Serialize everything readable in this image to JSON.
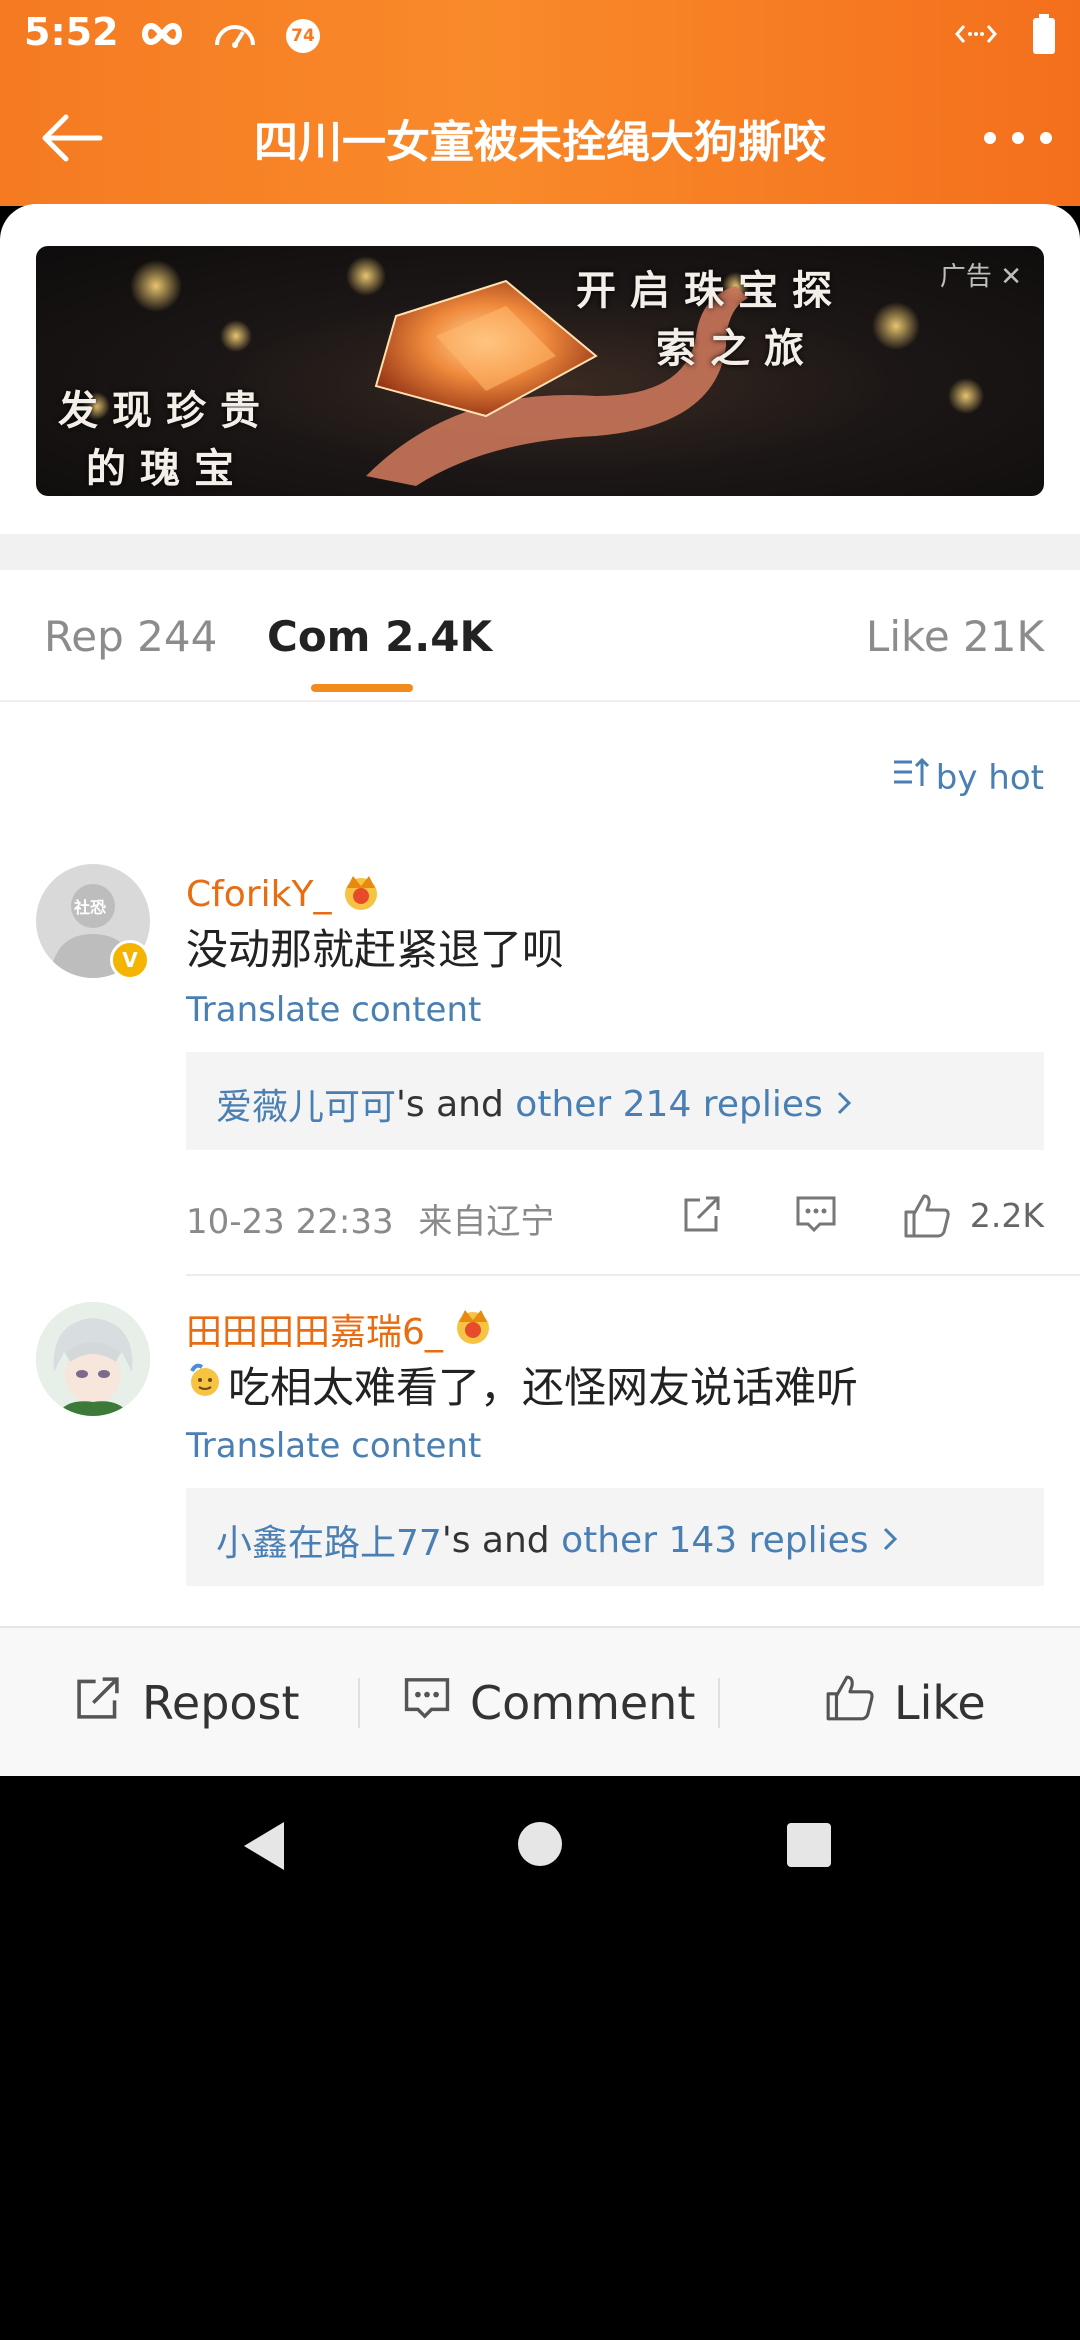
{
  "status_bar": {
    "time": "5:52",
    "badge_number": "74",
    "left_icons": [
      "infinity-icon",
      "speedometer-icon",
      "notification-badge-icon"
    ],
    "right_icons": [
      "data-transfer-icon",
      "battery-icon"
    ]
  },
  "nav": {
    "title": "四川一女童被未拴绳大狗撕咬",
    "back_icon": "arrow-left-icon",
    "more_icon": "more-dots-icon"
  },
  "ad": {
    "text_left_line1": "发现珍贵",
    "text_left_line2": "的瑰宝",
    "text_right_line1": "开启珠宝探",
    "text_right_line2": "索之旅",
    "label": "广告",
    "close": "✕"
  },
  "tabs": [
    {
      "label": "Rep 244",
      "active": false
    },
    {
      "label": "Com 2.4K",
      "active": true
    },
    {
      "label": "Like 21K",
      "active": false
    }
  ],
  "sort": {
    "label": "by hot",
    "icon": "sort-icon"
  },
  "comments": [
    {
      "username": "CforikY_",
      "avatar_text": "社恐",
      "verified_badge": "V",
      "text": "没动那就赶紧退了呗",
      "translate": "Translate content",
      "replies_user": "爱薇儿可可",
      "replies_mid": "'s and ",
      "replies_more": "other 214 replies",
      "date": "10-23 22:33",
      "location": "来自辽宁",
      "like_count": "2.2K"
    },
    {
      "username": "田田田田嘉瑞6_",
      "text": "吃相太难看了，还怪网友说话难听",
      "translate": "Translate content",
      "replies_user": "小鑫在路上77",
      "replies_mid": "'s and ",
      "replies_more": "other 143 replies"
    }
  ],
  "bottom_bar": {
    "repost": "Repost",
    "comment": "Comment",
    "like": "Like"
  },
  "colors": {
    "header_orange": "#f57a22",
    "username_orange": "#e86d12",
    "link_blue": "#4a7fb3",
    "tab_indicator": "#f38a1e"
  }
}
